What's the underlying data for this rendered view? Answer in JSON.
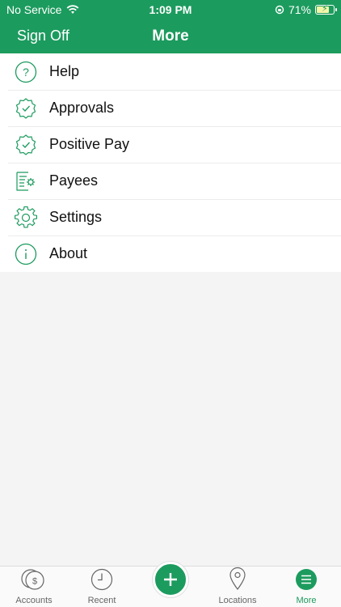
{
  "status_bar": {
    "carrier": "No Service",
    "time": "1:09 PM",
    "battery_percent": "71%",
    "battery_level": 0.71
  },
  "nav": {
    "title": "More",
    "sign_off_label": "Sign Off"
  },
  "menu": {
    "items": [
      {
        "label": "Help",
        "icon": "help-icon"
      },
      {
        "label": "Approvals",
        "icon": "approvals-badge-icon"
      },
      {
        "label": "Positive Pay",
        "icon": "positive-pay-badge-icon"
      },
      {
        "label": "Payees",
        "icon": "payees-icon"
      },
      {
        "label": "Settings",
        "icon": "gear-icon"
      },
      {
        "label": "About",
        "icon": "info-icon"
      }
    ]
  },
  "tabbar": {
    "tabs": [
      {
        "label": "Accounts",
        "icon": "accounts-coins-icon"
      },
      {
        "label": "Recent",
        "icon": "clock-icon"
      },
      {
        "label": "Locations",
        "icon": "location-pin-icon"
      },
      {
        "label": "More",
        "icon": "menu-icon",
        "active": true
      }
    ],
    "fab_icon": "plus-icon"
  },
  "colors": {
    "brand_green": "#1c9b5e",
    "background": "#f5f4f4"
  }
}
